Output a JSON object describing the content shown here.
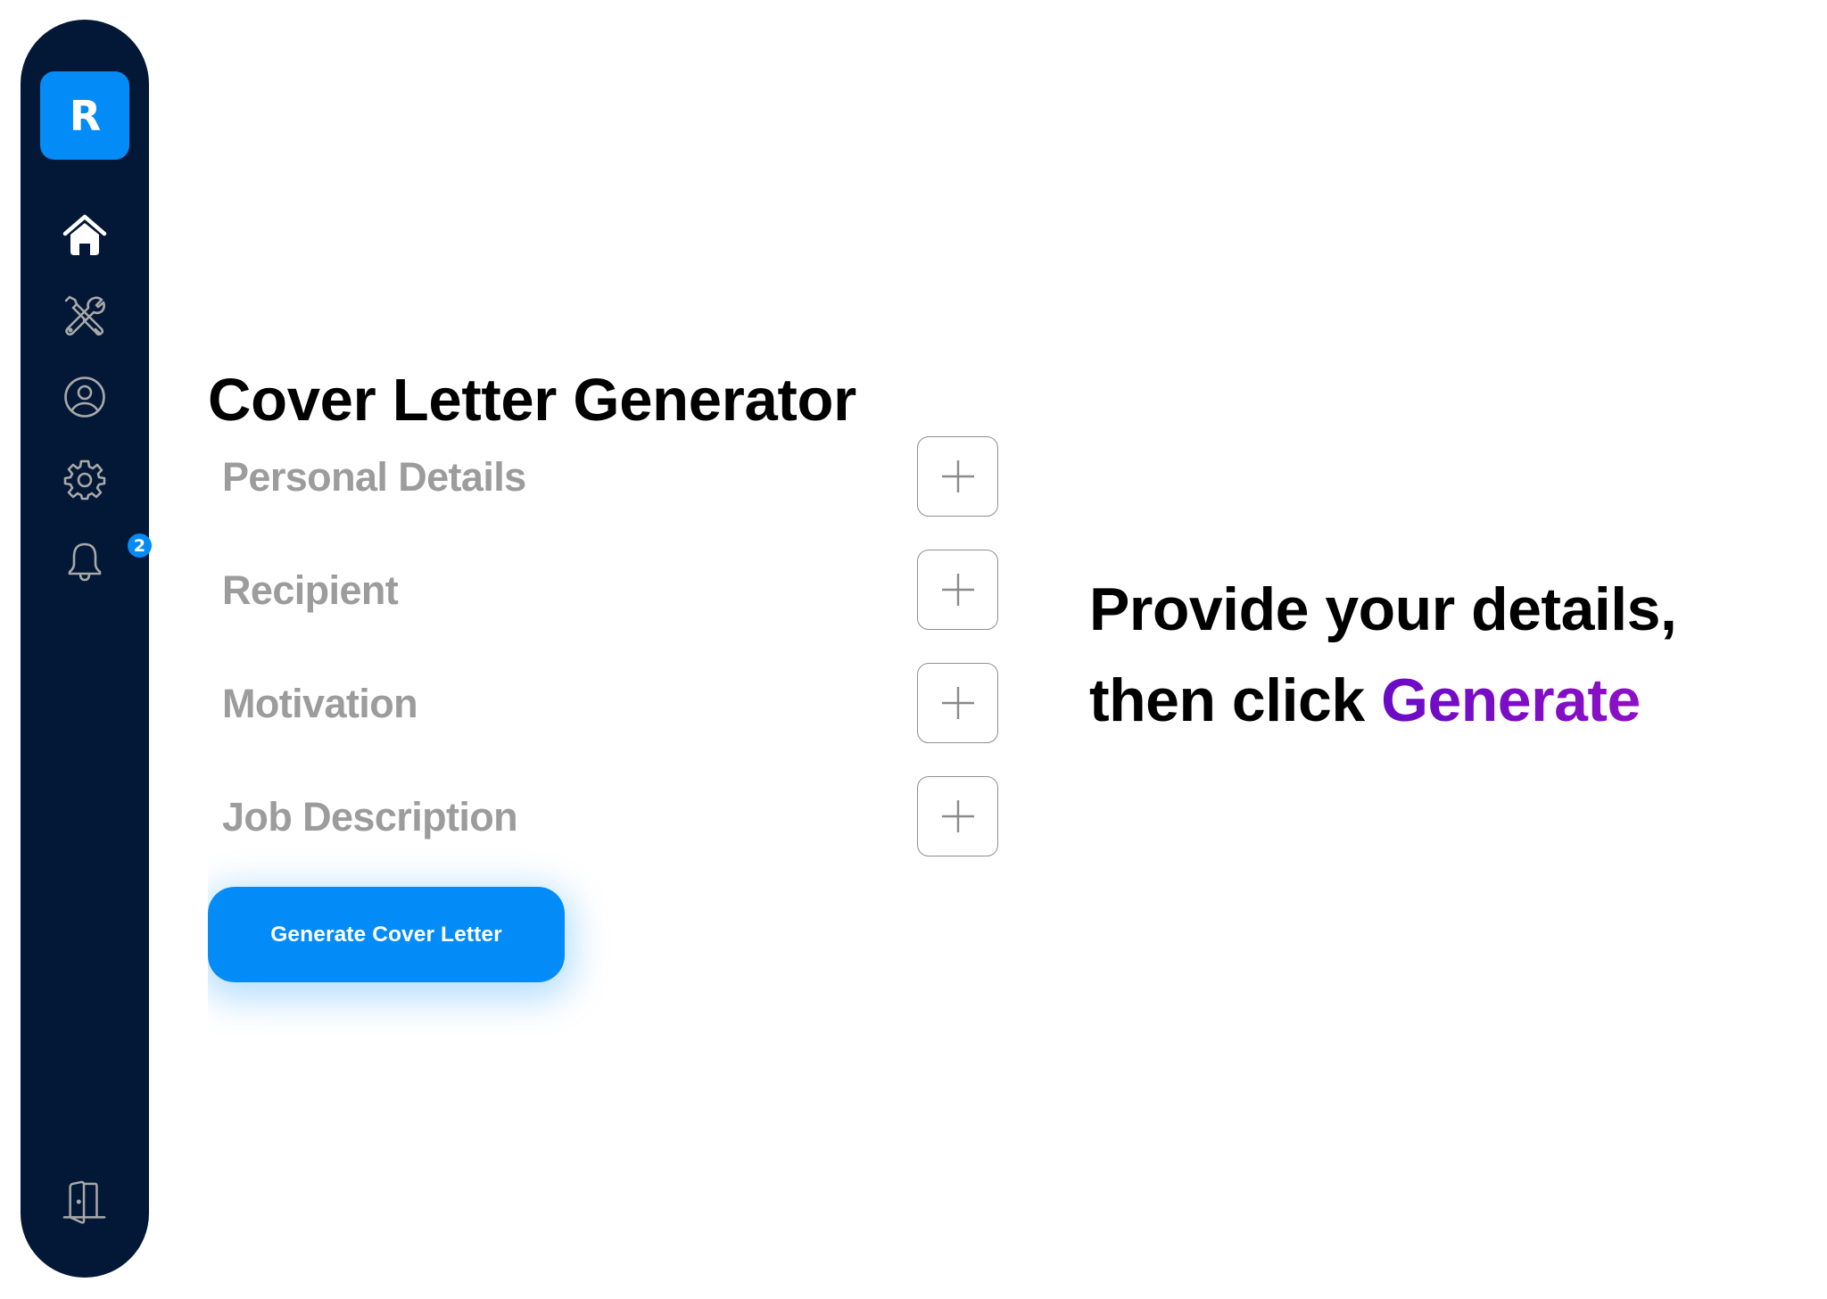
{
  "sidebar": {
    "logo_letter": "R",
    "items": [
      {
        "name": "home",
        "icon": "home-icon",
        "active": true
      },
      {
        "name": "tools",
        "icon": "tools-icon",
        "active": false
      },
      {
        "name": "profile",
        "icon": "user-circle-icon",
        "active": false
      },
      {
        "name": "settings",
        "icon": "gear-icon",
        "active": false
      },
      {
        "name": "notifications",
        "icon": "bell-icon",
        "active": false,
        "badge": "2"
      }
    ],
    "footer_item": {
      "name": "logout",
      "icon": "door-icon"
    }
  },
  "main": {
    "title": "Cover Letter Generator",
    "sections": [
      {
        "label": "Personal Details",
        "action_icon": "plus-icon"
      },
      {
        "label": "Recipient",
        "action_icon": "plus-icon"
      },
      {
        "label": "Motivation",
        "action_icon": "plus-icon"
      },
      {
        "label": "Job Description",
        "action_icon": "plus-icon"
      }
    ],
    "generate_button_label": "Generate Cover Letter"
  },
  "prompt": {
    "line1": "Provide your details,",
    "line2_prefix": "then click ",
    "line2_accent": "Generate"
  },
  "colors": {
    "sidebar_bg": "#021836",
    "brand_blue": "#038cf8",
    "label_gray": "#9c9c9c",
    "accent_gradient_start": "#6a0bc6",
    "accent_gradient_end": "#8d10c4"
  }
}
